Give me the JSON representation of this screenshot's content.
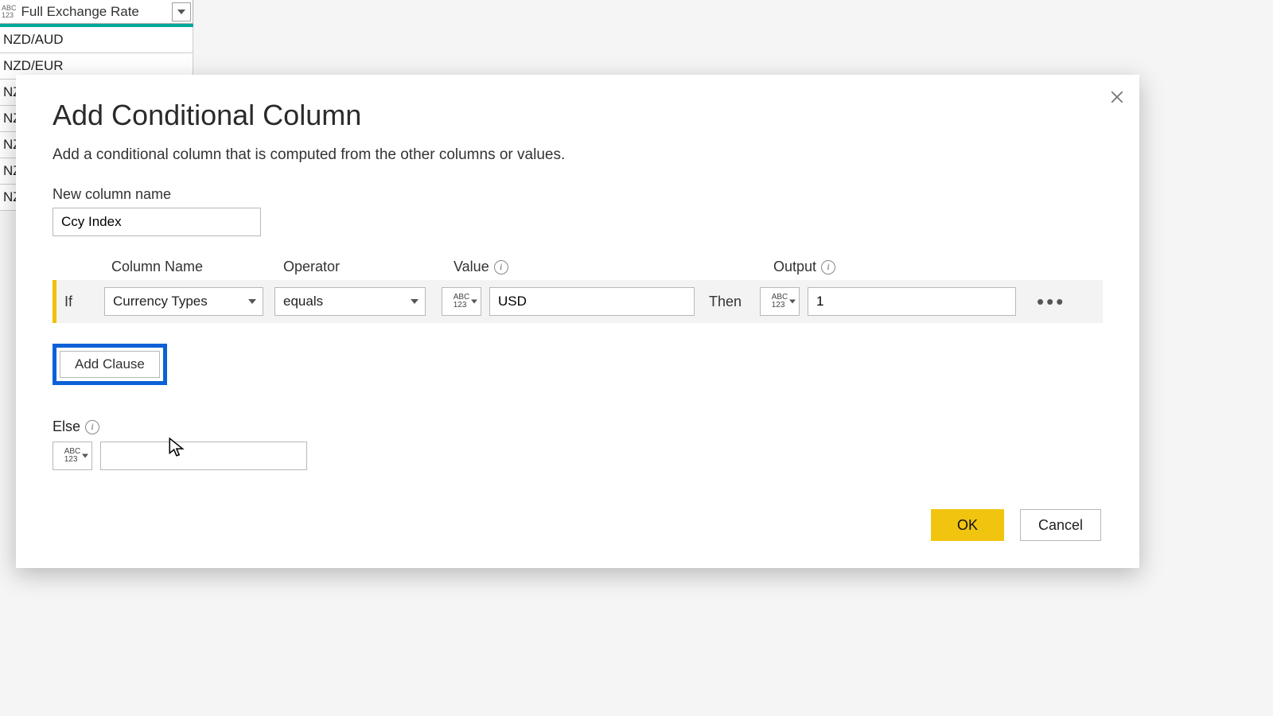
{
  "bg_table": {
    "header": "Full Exchange Rate",
    "rows": [
      "NZD/AUD",
      "NZD/EUR",
      "NZ",
      "NZ",
      "NZ",
      "NZ",
      "NZ"
    ]
  },
  "dialog": {
    "title": "Add Conditional Column",
    "description": "Add a conditional column that is computed from the other columns or values.",
    "new_column_label": "New column name",
    "new_column_value": "Ccy Index",
    "headers": {
      "col": "Column Name",
      "oper": "Operator",
      "val": "Value",
      "out": "Output"
    },
    "clause": {
      "if": "If",
      "column": "Currency Types",
      "operator": "equals",
      "value": "USD",
      "then": "Then",
      "output": "1"
    },
    "type_glyph_top": "ABC",
    "type_glyph_bot": "123",
    "add_clause": "Add Clause",
    "else_label": "Else",
    "else_value": "",
    "ok": "OK",
    "cancel": "Cancel"
  }
}
